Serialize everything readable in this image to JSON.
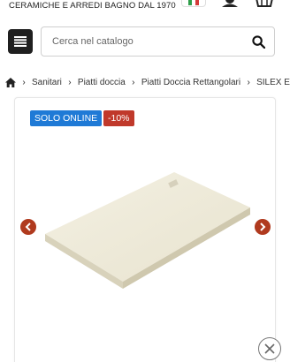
{
  "header": {
    "tagline": "CERAMICHE E ARREDI BAGNO DAL 1970",
    "language_flag": "flag-italy-icon",
    "flag_colors": [
      "#2e9e4a",
      "#ffffff",
      "#d43a3a"
    ]
  },
  "search": {
    "placeholder": "Cerca nel catalogo",
    "menu_icon": "hamburger-menu-icon",
    "search_icon": "magnifier-icon"
  },
  "breadcrumb": {
    "items": [
      "Sanitari",
      "Piatti doccia",
      "Piatti Doccia Rettangolari",
      "SILEX E"
    ]
  },
  "product": {
    "badges": {
      "online": "SOLO ONLINE",
      "discount": "-10%"
    },
    "colors": {
      "online_badge": "#1f7ad6",
      "discount_badge": "#c0392b",
      "carousel_arrow": "#b03a1e"
    }
  }
}
